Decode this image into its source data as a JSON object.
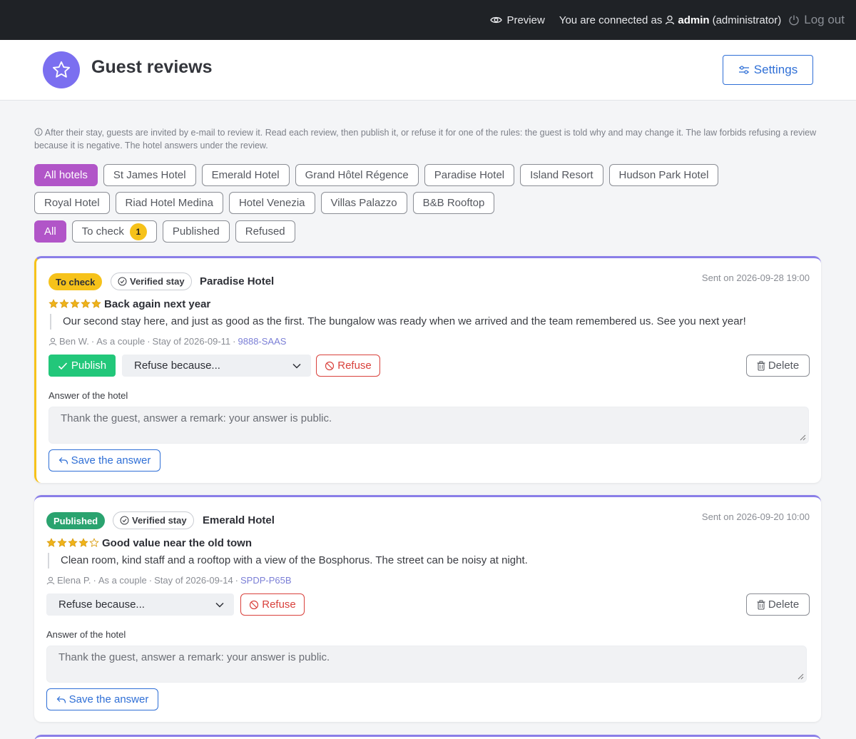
{
  "topbar": {
    "preview_label": "Preview",
    "connected_prefix": "You are connected as",
    "user_name": "admin",
    "user_role": "(administrator)",
    "logout_label": "Log out"
  },
  "header": {
    "title": "Guest reviews",
    "settings_label": "Settings"
  },
  "info_text": "After their stay, guests are invited by e-mail to review it. Read each review, then publish it, or refuse it for one of the rules: the guest is told why and may change it. The law forbids refusing a review because it is negative. The hotel answers under the review.",
  "hotel_filters": [
    "All hotels",
    "St James Hotel",
    "Emerald Hotel",
    "Grand Hôtel Régence",
    "Paradise Hotel",
    "Island Resort",
    "Hudson Park Hotel",
    "Royal Hotel",
    "Riad Hotel Medina",
    "Hotel Venezia",
    "Villas Palazzo",
    "B&B Rooftop"
  ],
  "status_filters": {
    "all": "All",
    "to_check": "To check",
    "to_check_count": "1",
    "published": "Published",
    "refused": "Refused"
  },
  "reviews": [
    {
      "status": "To check",
      "verified": "Verified stay",
      "hotel": "Paradise Hotel",
      "sent": "Sent on 2026-09-28 19:00",
      "rating": 5,
      "title": "Back again next year",
      "text": "Our second stay here, and just as good as the first. The bungalow was ready when we arrived and the team remembered us. See you next year!",
      "author": "Ben W.",
      "party": "As a couple",
      "stay": "Stay of 2026-09-11",
      "booking_ref": "9888-SAAS",
      "publish_label": "Publish",
      "refuse_select": "Refuse because...",
      "refuse_label": "Refuse",
      "delete_label": "Delete",
      "answer_label": "Answer of the hotel",
      "answer_placeholder": "Thank the guest, answer a remark: your answer is public.",
      "save_label": "Save the answer"
    },
    {
      "status": "Published",
      "verified": "Verified stay",
      "hotel": "Emerald Hotel",
      "sent": "Sent on 2026-09-20 10:00",
      "rating": 4,
      "title": "Good value near the old town",
      "text": "Clean room, kind staff and a rooftop with a view of the Bosphorus. The street can be noisy at night.",
      "author": "Elena P.",
      "party": "As a couple",
      "stay": "Stay of 2026-09-14",
      "booking_ref": "SPDP-P65B",
      "refuse_select": "Refuse because...",
      "refuse_label": "Refuse",
      "delete_label": "Delete",
      "answer_label": "Answer of the hotel",
      "answer_placeholder": "Thank the guest, answer a remark: your answer is public.",
      "save_label": "Save the answer"
    }
  ],
  "colors": {
    "accent": "#b155c8",
    "link": "#2f6fd6",
    "to_check": "#f6c21a",
    "published": "#2aa36f",
    "publish_button": "#22c77a",
    "refuse": "#d9413c",
    "card_top": "#8a7ee8"
  }
}
